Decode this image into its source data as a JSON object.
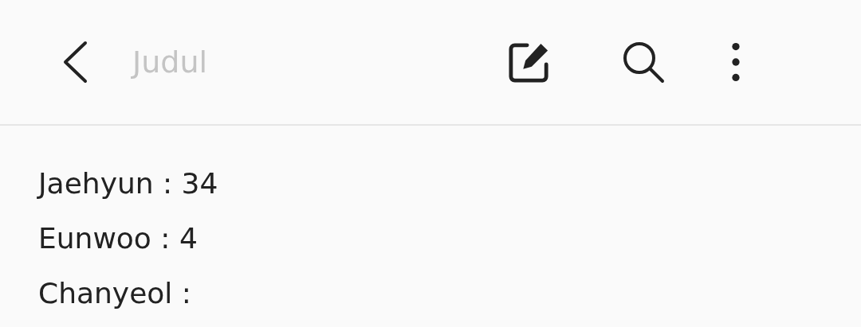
{
  "toolbar": {
    "title_field": {
      "placeholder": "Judul"
    }
  },
  "note": {
    "lines": [
      "Jaehyun : 34",
      "Eunwoo : 4",
      "Chanyeol :"
    ]
  }
}
